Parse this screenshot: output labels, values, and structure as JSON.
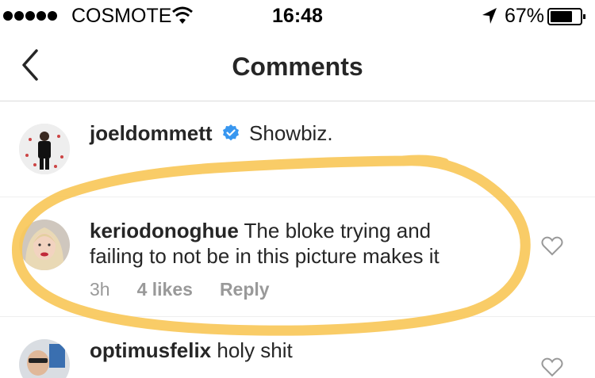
{
  "status_bar": {
    "carrier": "COSMOTE",
    "time": "16:48",
    "battery_percent": "67%",
    "battery_level": 0.67
  },
  "nav": {
    "title": "Comments"
  },
  "comments": [
    {
      "username": "joeldommett",
      "verified": true,
      "text": "Showbiz."
    },
    {
      "username": "keriodonoghue",
      "text_line1": "The bloke trying and",
      "text_line2": "failing to not be in this picture makes it",
      "age": "3h",
      "likes": "4 likes",
      "reply": "Reply"
    },
    {
      "username": "optimusfelix",
      "text": "holy shit"
    }
  ],
  "colors": {
    "highlight": "#F8C85A",
    "verified": "#3897F0",
    "meta_text": "#999999"
  }
}
